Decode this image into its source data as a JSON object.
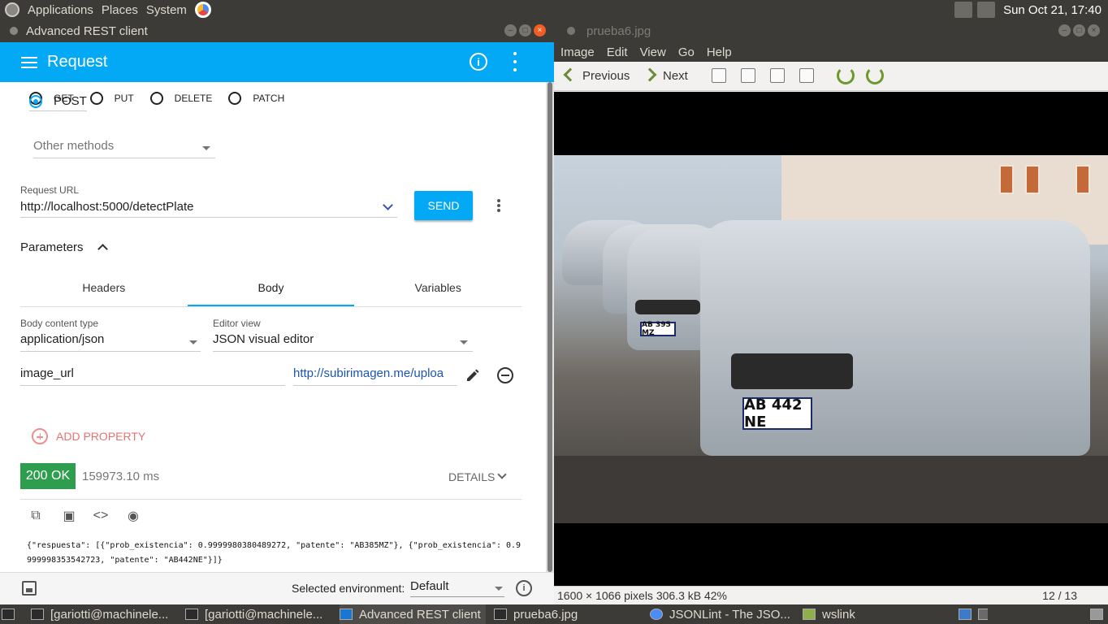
{
  "topbar": {
    "menus": [
      "Applications",
      "Places",
      "System"
    ],
    "clock": "Sun Oct 21, 17:40"
  },
  "left_window": {
    "title": "Advanced REST client",
    "appbar_title": "Request",
    "methods": [
      {
        "label": "GET",
        "selected": false
      },
      {
        "label": "POST",
        "selected": true
      },
      {
        "label": "PUT",
        "selected": false
      },
      {
        "label": "DELETE",
        "selected": false
      },
      {
        "label": "PATCH",
        "selected": false
      }
    ],
    "other_methods": "Other methods",
    "request_url_label": "Request URL",
    "request_url": "http://localhost:5000/detectPlate",
    "send_label": "SEND",
    "parameters_label": "Parameters",
    "tabs": [
      "Headers",
      "Body",
      "Variables"
    ],
    "active_tab": "Body",
    "body_content_type_label": "Body content type",
    "body_content_type": "application/json",
    "editor_view_label": "Editor view",
    "editor_view": "JSON visual editor",
    "property_name": "image_url",
    "property_value": "http://subirimagen.me/uploa",
    "add_property": "ADD PROPERTY",
    "status": "200 OK",
    "response_time": "159973.10 ms",
    "details": "DETAILS",
    "response_body": "{\"respuesta\": [{\"prob_existencia\": 0.9999980380489272, \"patente\": \"AB385MZ\"}, {\"prob_existencia\": 0.9999998353542723, \"patente\": \"AB442NE\"}]}",
    "env_label": "Selected environment:",
    "env_value": "Default",
    "accent_color": "#03a9f4",
    "status_color": "#2e9d4e"
  },
  "right_window": {
    "title": "prueba6.jpg",
    "menus": [
      "Image",
      "Edit",
      "View",
      "Go",
      "Help"
    ],
    "previous": "Previous",
    "next": "Next",
    "plate_front": "AB 442 NE",
    "plate_back": "AB 395 MZ",
    "status_info": "1600 × 1066 pixels  306.3 kB   42%",
    "page": "12 / 13"
  },
  "taskbar": {
    "items": [
      "[gariotti@machinele...",
      "[gariotti@machinele...",
      "Advanced REST client",
      "prueba6.jpg",
      "JSONLint - The JSO...",
      "wslink"
    ]
  }
}
